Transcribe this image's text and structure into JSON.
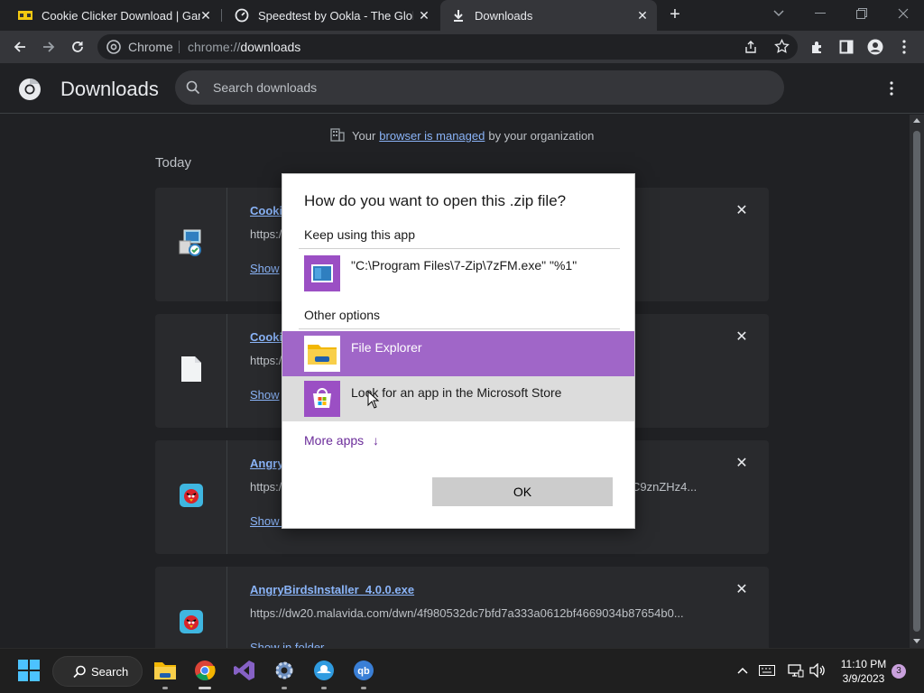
{
  "tabs": [
    {
      "title": "Cookie Clicker Download | Game",
      "active": false
    },
    {
      "title": "Speedtest by Ookla - The Global",
      "active": false
    },
    {
      "title": "Downloads",
      "active": true
    }
  ],
  "toolbar": {
    "site_label": "Chrome",
    "url_prefix": "chrome://",
    "url_path": "downloads"
  },
  "downloads_page": {
    "title": "Downloads",
    "search_placeholder": "Search downloads",
    "managed_prefix": "Your",
    "managed_link": "browser is managed",
    "managed_suffix": "by your organization",
    "date_group": "Today",
    "items": [
      {
        "name": "Cookie",
        "url": "https:/",
        "action": "Show",
        "icon": "installer-icon"
      },
      {
        "name": "Cookie",
        "url": "https:/",
        "action": "Show",
        "icon": "file-icon"
      },
      {
        "name": "Angry",
        "url": "https:/",
        "url_tail": "C9znZHz4...",
        "action": "Show in folder",
        "icon": "angry-birds-icon"
      },
      {
        "name": "AngryBirdsInstaller_4.0.0.exe",
        "url": "https://dw20.malavida.com/dwn/4f980532dc7bfd7a333a0612bf4669034b87654b0...",
        "action": "Show in folder",
        "icon": "angry-birds-icon"
      }
    ]
  },
  "dialog": {
    "title": "How do you want to open this .zip file?",
    "keep_label": "Keep using this app",
    "current_app": "\"C:\\Program Files\\7-Zip\\7zFM.exe\" \"%1\"",
    "other_label": "Other options",
    "options": [
      {
        "label": "File Explorer",
        "selected": true
      },
      {
        "label": "Look for an app in the Microsoft Store",
        "hovered": true
      }
    ],
    "more_apps": "More apps",
    "ok": "OK"
  },
  "taskbar": {
    "search_label": "Search",
    "time": "11:10 PM",
    "date": "3/9/2023",
    "notification_count": "3"
  },
  "colors": {
    "accent_purple": "#a066c8",
    "link_blue": "#8ab4f8",
    "bg_dark": "#202124"
  }
}
